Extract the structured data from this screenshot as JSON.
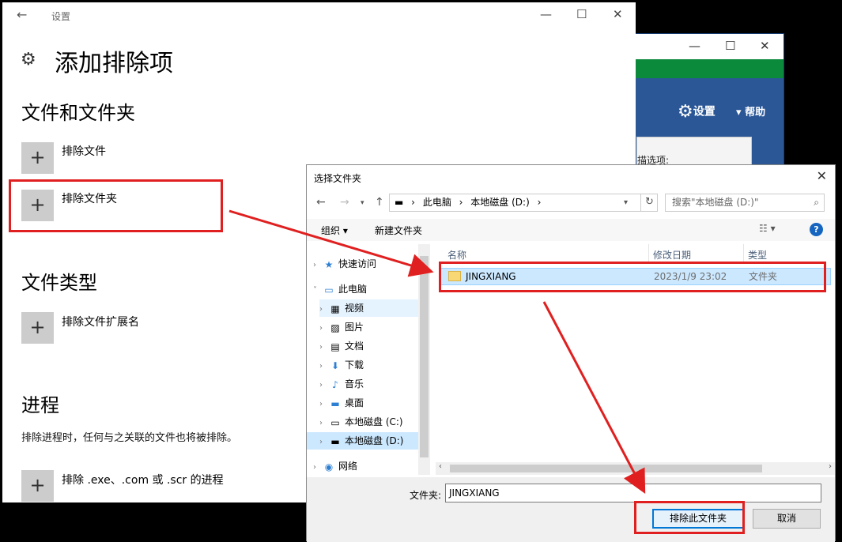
{
  "bg_window": {
    "settings_label": "设置",
    "help_label": "帮助",
    "scan_label": "描选项:",
    "colors": {
      "blue": "#2b5797",
      "green": "#0b8a3b"
    }
  },
  "settings": {
    "title": "设置",
    "heading": "添加排除项",
    "sections": {
      "files_folders": "文件和文件夹",
      "file_types": "文件类型",
      "processes": "进程"
    },
    "add_file": "排除文件",
    "add_folder": "排除文件夹",
    "add_extension": "排除文件扩展名",
    "process_desc": "排除进程时，任何与之关联的文件也将被排除。",
    "add_process": "排除 .exe、.com 或 .scr 的进程"
  },
  "dialog": {
    "title": "选择文件夹",
    "address": [
      "此电脑",
      "本地磁盘 (D:)"
    ],
    "search_placeholder": "搜索\"本地磁盘 (D:)\"",
    "organize": "组织 ▾",
    "new_folder": "新建文件夹",
    "tree": {
      "quick_access": "快速访问",
      "this_pc": "此电脑",
      "videos": "视频",
      "pictures": "图片",
      "documents": "文档",
      "downloads": "下载",
      "music": "音乐",
      "desktop": "桌面",
      "disk_c": "本地磁盘 (C:)",
      "disk_d": "本地磁盘 (D:)",
      "network": "网络"
    },
    "columns": {
      "name": "名称",
      "modified": "修改日期",
      "type": "类型"
    },
    "row": {
      "name": "JINGXIANG",
      "modified": "2023/1/9 23:02",
      "type": "文件夹"
    },
    "folder_label": "文件夹:",
    "folder_value": "JINGXIANG",
    "ok_button": "排除此文件夹",
    "cancel_button": "取消"
  },
  "highlight_color": "#e02020"
}
